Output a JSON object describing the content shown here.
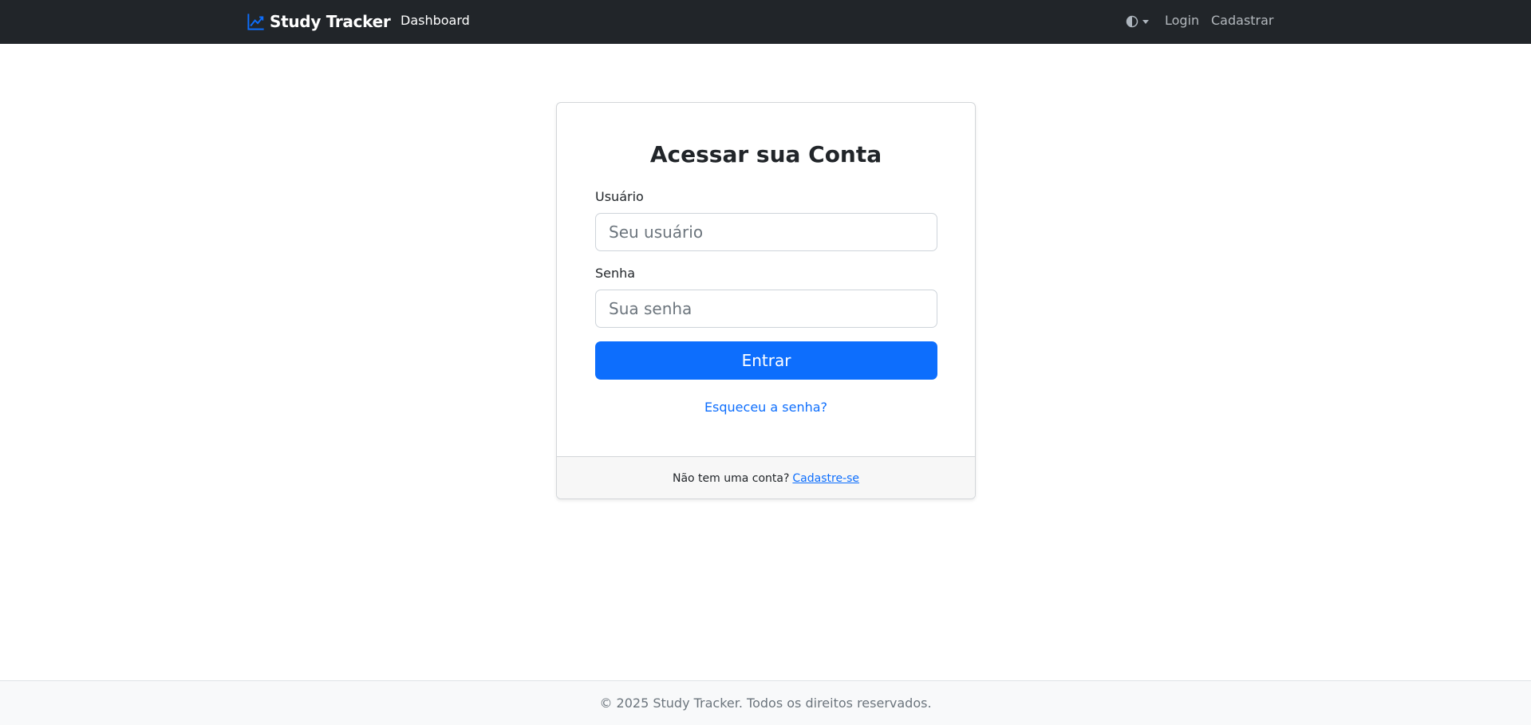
{
  "navbar": {
    "brand_icon": "chart-line-icon",
    "brand": "Study Tracker",
    "links": {
      "dashboard": "Dashboard",
      "login": "Login",
      "register": "Cadastrar"
    },
    "theme_icon": "contrast-half-circle-icon",
    "bg_color": "#212529"
  },
  "login_card": {
    "title": "Acessar sua Conta",
    "username_label": "Usuário",
    "username_placeholder": "Seu usuário",
    "password_label": "Senha",
    "password_placeholder": "Sua senha",
    "submit_label": "Entrar",
    "forgot_link": "Esqueceu a senha?",
    "footer_text": "Não tem uma conta?",
    "footer_link": "Cadastre-se",
    "accent_color": "#0d6efd"
  },
  "footer": {
    "copyright": "© 2025 Study Tracker. Todos os direitos reservados."
  }
}
